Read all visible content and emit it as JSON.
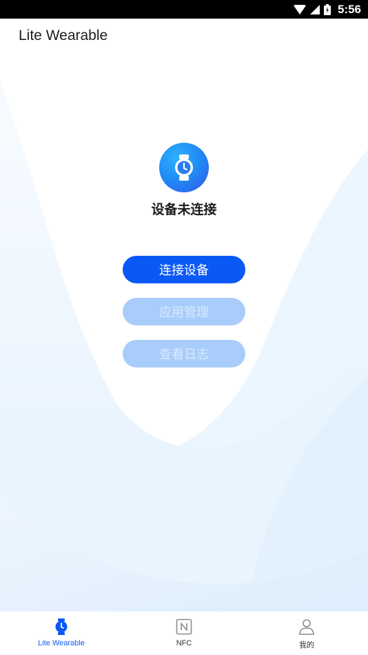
{
  "status_bar": {
    "time": "5:56"
  },
  "app": {
    "title": "Lite Wearable"
  },
  "device": {
    "status_text": "设备未连接"
  },
  "actions": {
    "connect_label": "连接设备",
    "manage_label": "应用管理",
    "log_label": "查看日志"
  },
  "tabs": [
    {
      "label": "Lite Wearable",
      "icon": "watch-icon",
      "active": true
    },
    {
      "label": "NFC",
      "icon": "nfc-icon",
      "active": false
    },
    {
      "label": "我的",
      "icon": "person-icon",
      "active": false
    }
  ],
  "colors": {
    "accent": "#0a59f7",
    "disabled_button": "#a9cdfb",
    "background_tint": "#e3f1fd"
  }
}
